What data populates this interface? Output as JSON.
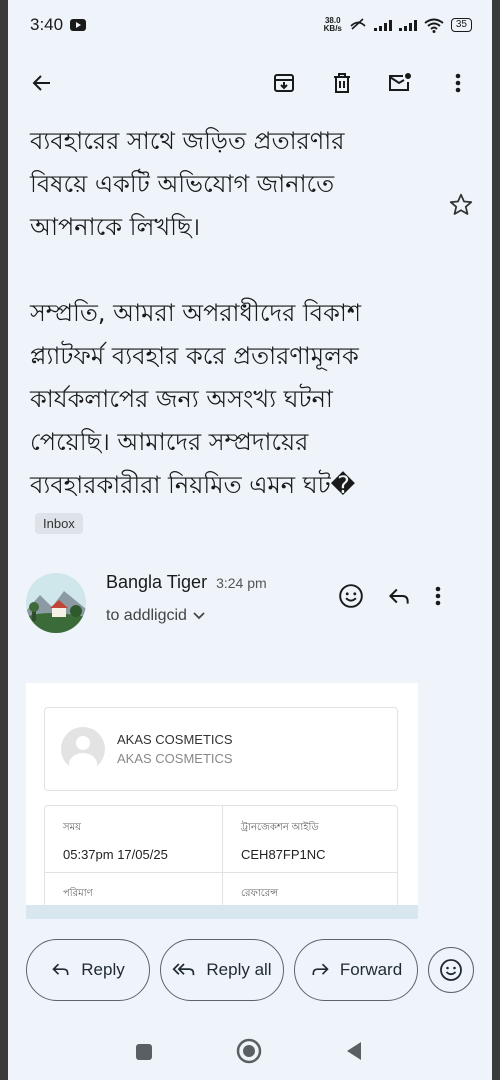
{
  "status": {
    "time": "3:40",
    "net_speed_value": "38.0",
    "net_speed_unit": "KB/s",
    "battery": "35"
  },
  "appbar": {
    "back": "back-arrow-icon",
    "archive": "archive-icon",
    "delete": "trash-icon",
    "mark_unread": "mail-unread-icon",
    "more": "more-vert-icon"
  },
  "email": {
    "body_text": "ব্যবহারের সাথে জড়িত প্রতারণার\nবিষয়ে একটি অভিযোগ জানাতে\nআপনাকে লিখছি।\n\nসম্প্রতি, আমরা অপরাধীদের বিকাশ\nপ্ল্যাটফর্ম ব্যবহার করে প্রতারণামূলক\nকার্যকলাপের জন্য অসংখ্য ঘটনা\nপেয়েছি। আমাদের সম্প্রদায়ের\nব্যবহারকারীরা নিয়মিত এমন ঘট�",
    "label": "Inbox"
  },
  "message": {
    "sender": "Bangla Tiger",
    "time": "3:24 pm",
    "recipient": "to addligcid"
  },
  "receipt": {
    "merchant_title": "AKAS COSMETICS",
    "merchant_subtitle": "AKAS COSMETICS",
    "time_label": "সময়",
    "time_value": "05:37pm 17/05/25",
    "txn_label": "ট্রানজেকশন আইডি",
    "txn_value": "CEH87FP1NC",
    "amount_label": "পরিমাণ",
    "ref_label": "রেফারেন্স"
  },
  "actions": {
    "reply": "Reply",
    "reply_all": "Reply all",
    "forward": "Forward"
  },
  "colors": {
    "background": "#eef4f9",
    "text": "#1a1a1a"
  }
}
